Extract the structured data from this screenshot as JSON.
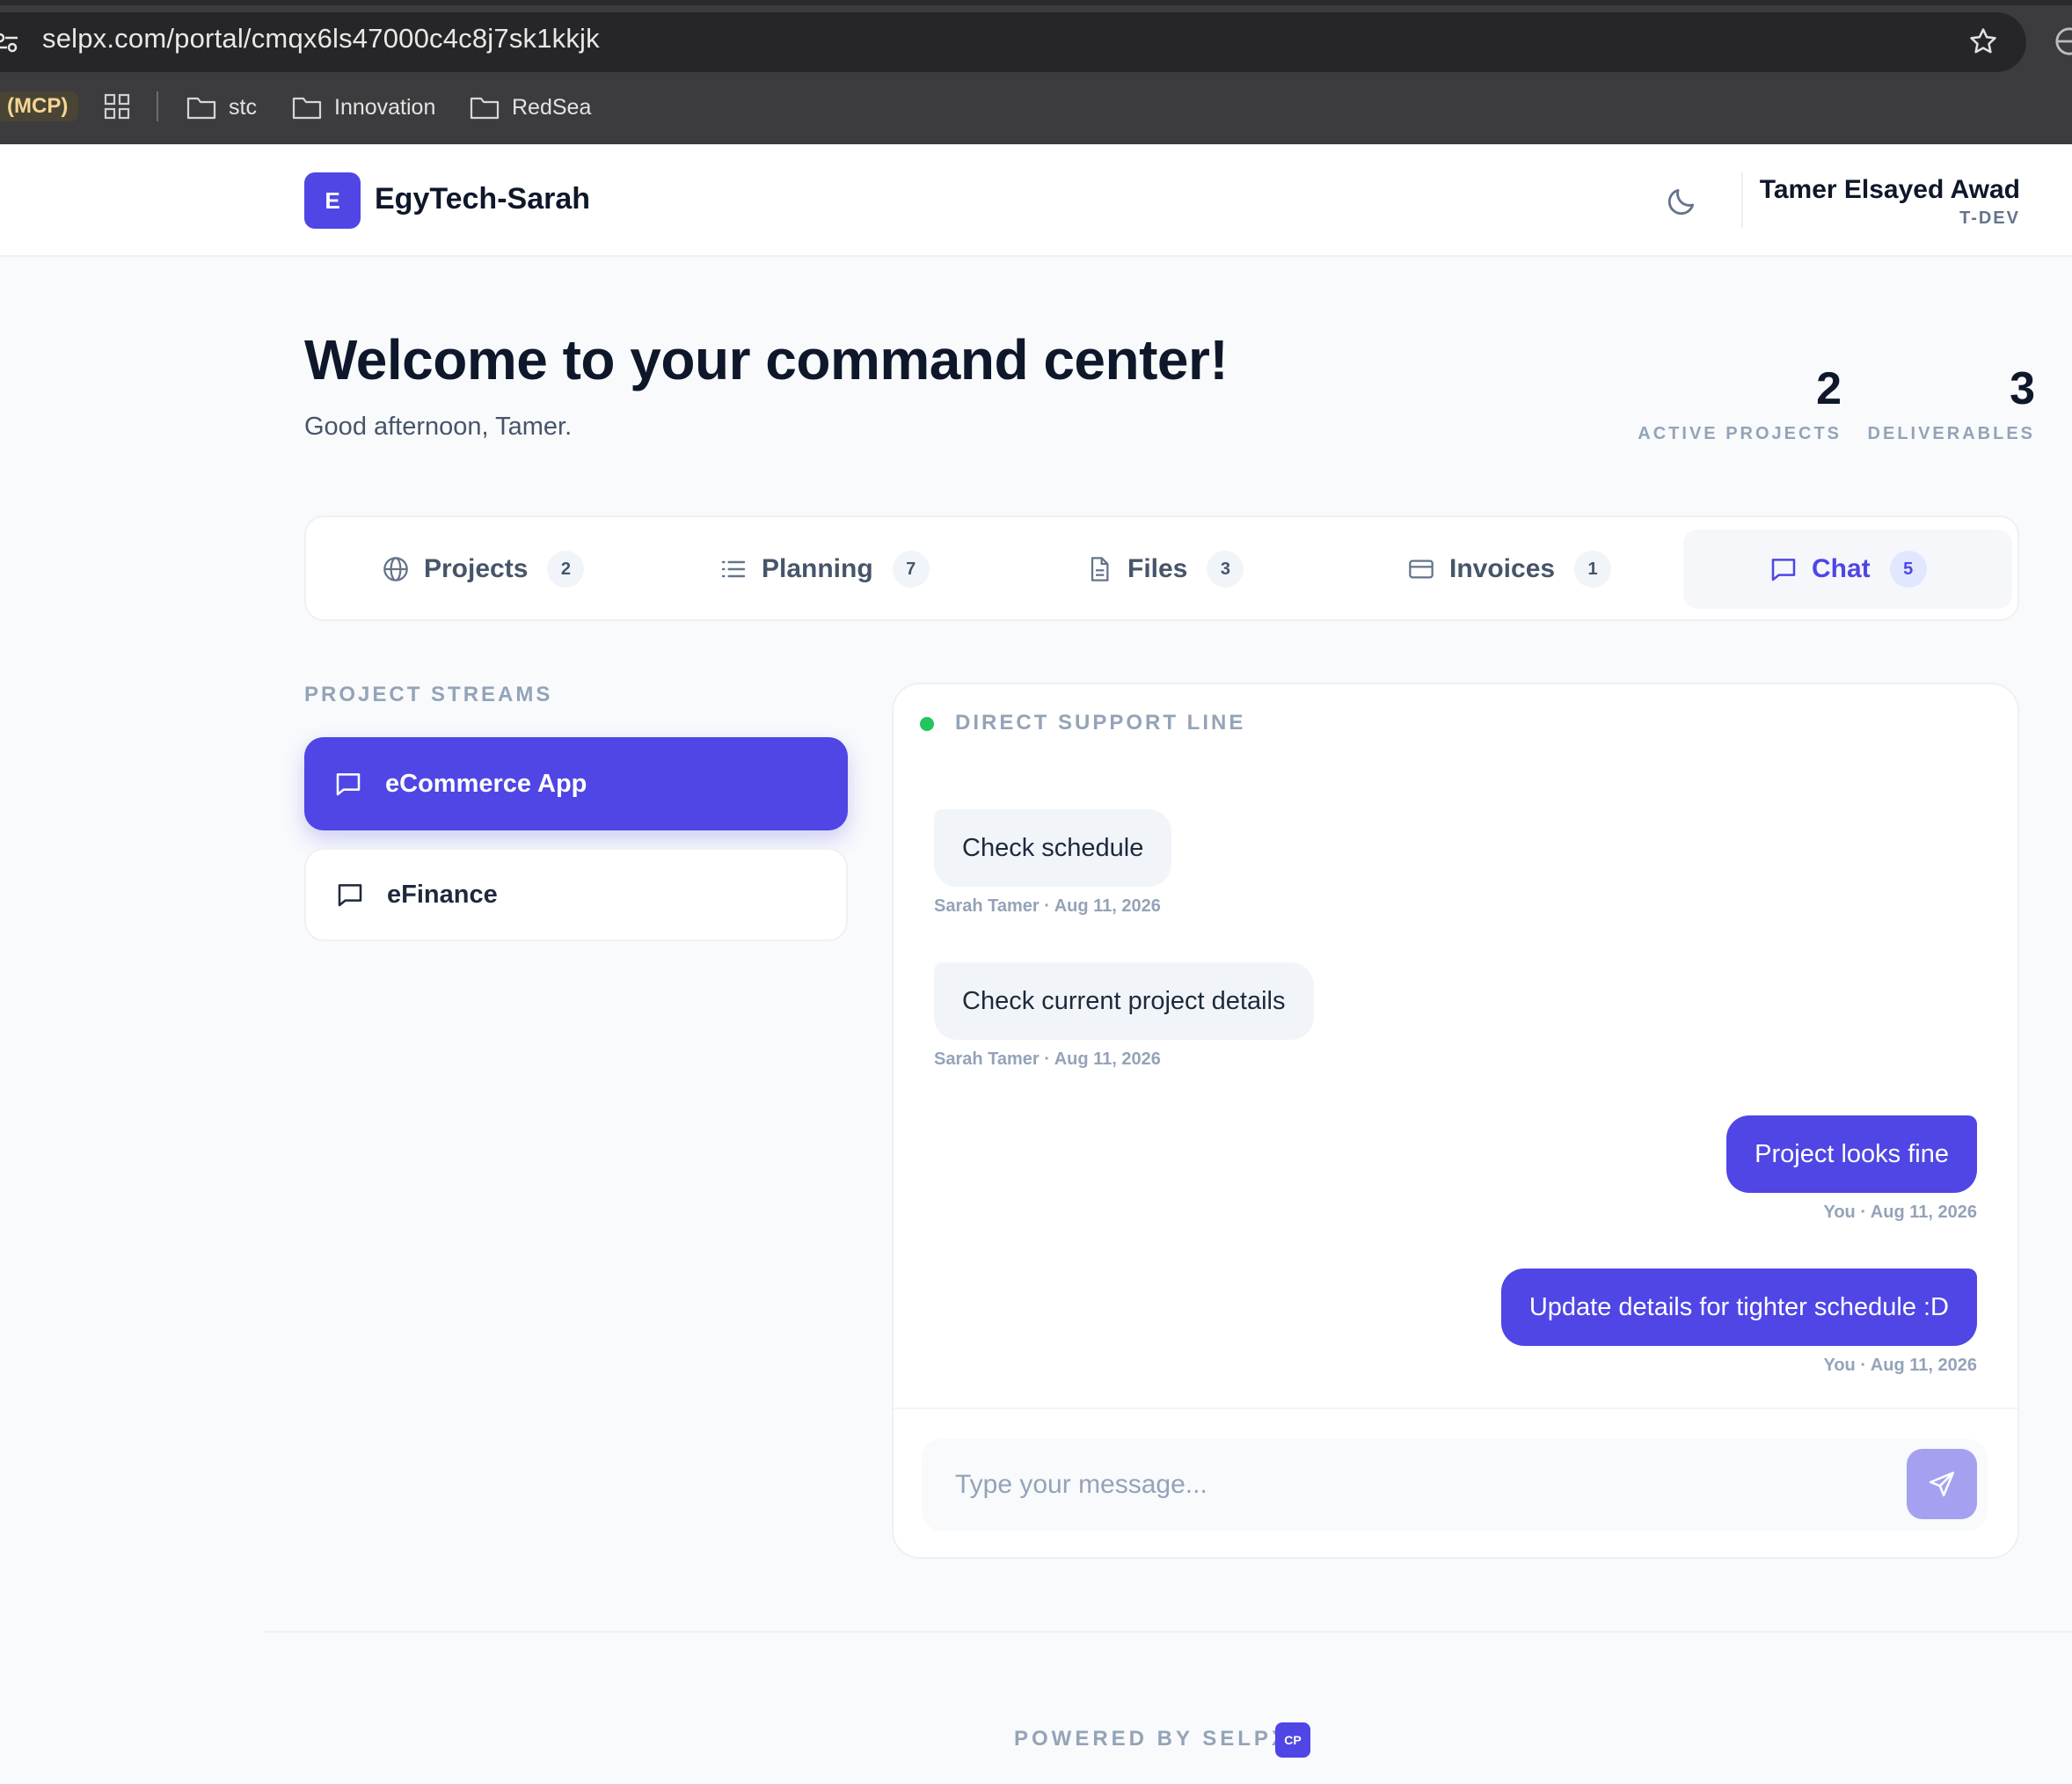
{
  "browser": {
    "url": "selpx.com/portal/cmqx6ls47000c4c8j7sk1kkjk",
    "bookmarks": {
      "mcp_label": "(MCP)",
      "folders": [
        "stc",
        "Innovation",
        "RedSea"
      ]
    }
  },
  "header": {
    "logo_letter": "E",
    "brand": "EgyTech-Sarah",
    "theme_icon": "moon-icon",
    "user": {
      "name": "Tamer Elsayed Awad",
      "role": "T-DEV"
    }
  },
  "welcome": {
    "title": "Welcome to your command center!",
    "greeting": "Good afternoon, Tamer.",
    "stats": [
      {
        "value": "2",
        "label": "ACTIVE PROJECTS"
      },
      {
        "value": "3",
        "label": "DELIVERABLES"
      }
    ]
  },
  "tabs": [
    {
      "label": "Projects",
      "count": "2",
      "icon": "globe-icon"
    },
    {
      "label": "Planning",
      "count": "7",
      "icon": "list-icon"
    },
    {
      "label": "Files",
      "count": "3",
      "icon": "file-icon"
    },
    {
      "label": "Invoices",
      "count": "1",
      "icon": "card-icon"
    },
    {
      "label": "Chat",
      "count": "5",
      "icon": "chat-icon",
      "active": true
    }
  ],
  "streams": {
    "title": "PROJECT STREAMS",
    "items": [
      {
        "label": "eCommerce App",
        "active": true
      },
      {
        "label": "eFinance",
        "active": false
      }
    ]
  },
  "chat": {
    "title": "DIRECT SUPPORT LINE",
    "status_color": "#22c55e",
    "messages": [
      {
        "text": "Check schedule",
        "meta": "Sarah Tamer · Aug 11, 2026",
        "direction": "in"
      },
      {
        "text": "Check current project details",
        "meta": "Sarah Tamer · Aug 11, 2026",
        "direction": "in"
      },
      {
        "text": "Project looks fine",
        "meta": "You · Aug 11, 2026",
        "direction": "out"
      },
      {
        "text": "Update details for tighter schedule :D",
        "meta": "You · Aug 11, 2026",
        "direction": "out"
      }
    ],
    "composer": {
      "placeholder": "Type your message...",
      "value": ""
    },
    "send_icon": "send-icon"
  },
  "footer": {
    "text": "POWERED BY SELPX",
    "logo": "CP"
  },
  "colors": {
    "accent": "#4f46e5",
    "chrome": "#3c3c3f",
    "background": "#f8fafc"
  }
}
